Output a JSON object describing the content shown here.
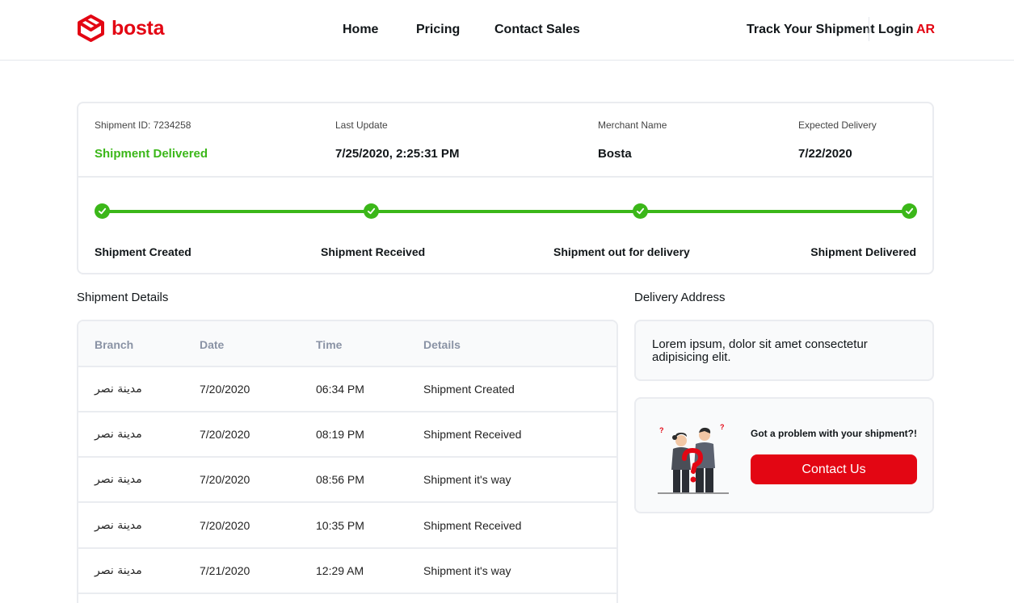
{
  "header": {
    "brand": "bosta",
    "nav": [
      "Home",
      "Pricing",
      "Contact Sales"
    ],
    "track_link": "Track Your Shipment",
    "login": "Login",
    "lang": "AR"
  },
  "status": {
    "shipment_id_label": "Shipment ID: 7234258",
    "state": "Shipment Delivered",
    "last_update_label": "Last Update",
    "last_update_value": "7/25/2020, 2:25:31 PM",
    "merchant_label": "Merchant Name",
    "merchant_value": "Bosta",
    "expected_label": "Expected Delivery",
    "expected_value": "7/22/2020",
    "steps": [
      "Shipment Created",
      "Shipment Received",
      "Shipment out for delivery",
      "Shipment Delivered"
    ],
    "progress": 1.0,
    "accent_color": "#3bb719"
  },
  "details": {
    "title": "Shipment Details",
    "columns": [
      "Branch",
      "Date",
      "Time",
      "Details"
    ],
    "rows": [
      [
        "مدينة نصر",
        "7/20/2020",
        "06:34 PM",
        "Shipment Created"
      ],
      [
        "مدينة نصر",
        "7/20/2020",
        "08:19 PM",
        "Shipment Received"
      ],
      [
        "مدينة نصر",
        "7/20/2020",
        "08:56 PM",
        "Shipment it's way"
      ],
      [
        "مدينة نصر",
        "7/20/2020",
        "10:35 PM",
        "Shipment Received"
      ],
      [
        "مدينة نصر",
        "7/21/2020",
        "12:29 AM",
        "Shipment it's way"
      ]
    ]
  },
  "address": {
    "title": "Delivery Address",
    "text": "Lorem ipsum, dolor sit amet consectetur adipisicing elit."
  },
  "help": {
    "title": "Got a problem with your shipment?!",
    "button": "Contact Us",
    "brand_color": "#e30613"
  }
}
